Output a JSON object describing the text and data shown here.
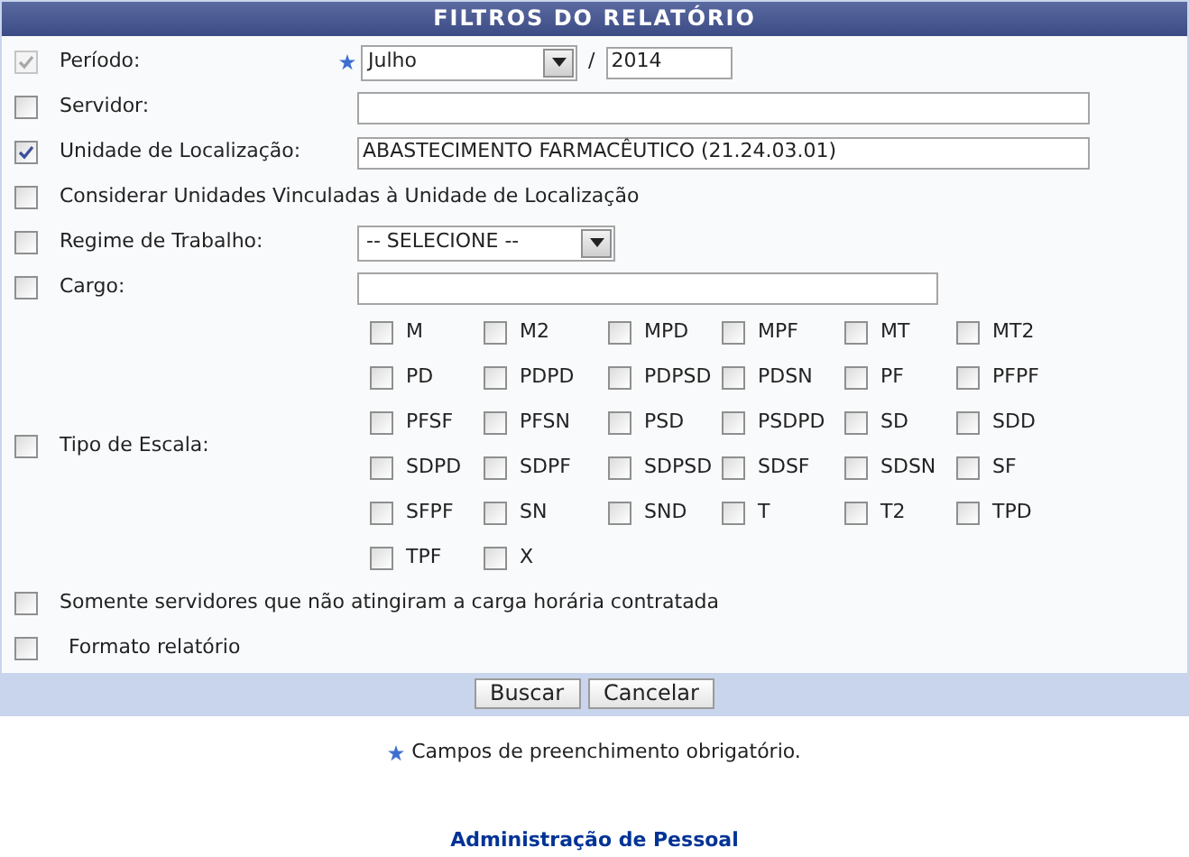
{
  "panel": {
    "title": "FILTROS DO RELATÓRIO"
  },
  "filters": [
    {
      "kind": "period",
      "label": "Período:",
      "checked": true,
      "disabled": true,
      "required": true,
      "month": "Julho",
      "separator": "/",
      "year": "2014"
    },
    {
      "kind": "text",
      "label": "Servidor:",
      "checked": false,
      "disabled": false,
      "required": false
    },
    {
      "kind": "text",
      "label": "Unidade de Localização:",
      "checked": true,
      "disabled": false,
      "required": false,
      "value": "ABASTECIMENTO FARMACÊUTICO (21.24.03.01)"
    },
    {
      "kind": "flag",
      "label": "Considerar Unidades Vinculadas à Unidade de Localização",
      "checked": false,
      "disabled": false,
      "required": false
    },
    {
      "kind": "select",
      "label": "Regime de Trabalho:",
      "checked": false,
      "disabled": false,
      "required": false,
      "value": "-- SELECIONE --"
    },
    {
      "kind": "shorttext",
      "label": "Cargo:",
      "checked": false,
      "disabled": false,
      "required": false
    },
    {
      "kind": "scales",
      "label": "Tipo de Escala:",
      "checked": false,
      "disabled": false,
      "required": false,
      "options": [
        {
          "label": "M",
          "checked": false
        },
        {
          "label": "M2",
          "checked": false
        },
        {
          "label": "MPD",
          "checked": false
        },
        {
          "label": "MPF",
          "checked": false
        },
        {
          "label": "MT",
          "checked": false
        },
        {
          "label": "MT2",
          "checked": false
        },
        {
          "label": "PD",
          "checked": false
        },
        {
          "label": "PDPD",
          "checked": false
        },
        {
          "label": "PDPSD",
          "checked": false
        },
        {
          "label": "PDSN",
          "checked": false
        },
        {
          "label": "PF",
          "checked": false
        },
        {
          "label": "PFPF",
          "checked": false
        },
        {
          "label": "PFSF",
          "checked": false
        },
        {
          "label": "PFSN",
          "checked": false
        },
        {
          "label": "PSD",
          "checked": false
        },
        {
          "label": "PSDPD",
          "checked": false
        },
        {
          "label": "SD",
          "checked": false
        },
        {
          "label": "SDD",
          "checked": false
        },
        {
          "label": "SDPD",
          "checked": false
        },
        {
          "label": "SDPF",
          "checked": false
        },
        {
          "label": "SDPSD",
          "checked": false
        },
        {
          "label": "SDSF",
          "checked": false
        },
        {
          "label": "SDSN",
          "checked": false
        },
        {
          "label": "SF",
          "checked": false
        },
        {
          "label": "SFPF",
          "checked": false
        },
        {
          "label": "SN",
          "checked": false
        },
        {
          "label": "SND",
          "checked": false
        },
        {
          "label": "T",
          "checked": false
        },
        {
          "label": "T2",
          "checked": false
        },
        {
          "label": "TPD",
          "checked": false
        },
        {
          "label": "TPF",
          "checked": false
        },
        {
          "label": "X",
          "checked": false
        }
      ]
    },
    {
      "kind": "flag",
      "label": "Somente servidores que não atingiram a carga horária contratada",
      "checked": false,
      "disabled": false,
      "required": false
    },
    {
      "kind": "flag",
      "label": "Formato relatório",
      "checked": false,
      "disabled": false,
      "required": false
    }
  ],
  "buttons": [
    "Buscar",
    "Cancelar"
  ],
  "note": "Campos de preenchimento obrigatório.",
  "footer_link": "Administração de Pessoal"
}
